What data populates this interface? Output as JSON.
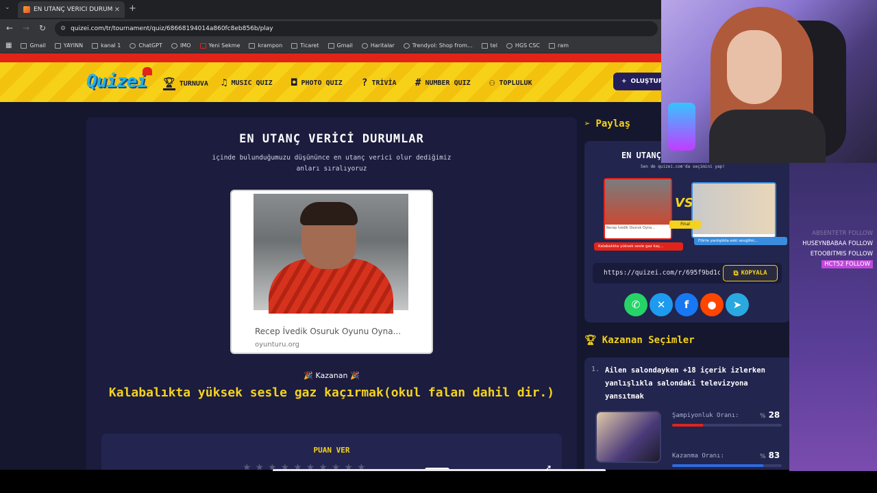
{
  "browser": {
    "tab_title": "EN UTANÇ VERİCİ DURUMLAR",
    "url": "quizei.com/tr/tournament/quiz/68668194014a860fc8eb856b/play",
    "bookmarks": [
      "Gmail",
      "YAYINN",
      "kanal 1",
      "ChatGPT",
      "IMO",
      "Yeni Sekme",
      "krampon",
      "Ticaret",
      "Gmail",
      "Haritalar",
      "Trendyol: Shop from...",
      "tel",
      "HGS CSC",
      "ram"
    ]
  },
  "site": {
    "logo": "Quizei",
    "nav": [
      "TURNUVA",
      "MUSIC QUIZ",
      "PHOTO QUIZ",
      "TRİVİA",
      "NUMBER QUIZ",
      "TOPLULUK"
    ],
    "create_label": "OLUŞTUR"
  },
  "quiz": {
    "title": "EN UTANÇ VERİCİ DURUMLAR",
    "subtitle": "içinde bulunduğumuzu düşününce en utanç verici olur dediğimiz anları sıralıyoruz",
    "image_caption": "Recep İvedik Osuruk Oyunu Oyna...",
    "image_source": "oyunturu.org",
    "winner_label": "🎉  Kazanan  🎉",
    "winner_text": "Kalabalıkta yüksek sesle gaz kaçırmak(okul falan dahil dir.)",
    "rate_label": "PUAN VER",
    "stars": "★★★★★★★★★★"
  },
  "share": {
    "title": "Paylaş",
    "preview_title": "EN UTANÇ",
    "preview_sub": "Sen de quizei.com'da seçimini yap!",
    "preview_logo": "Quizei",
    "preview_vs": "VS",
    "preview_final": "Final",
    "preview_a_caption": "Recep İvedik Osuruk Oyna...",
    "preview_a_label": "Kalabalıkta yüksek sesle gaz kaç...",
    "preview_b_label": "Flörte yanlışlıkla eski sevgilini...",
    "link": "https://quizei.com/r/695f9bd1c",
    "copy_label": "KOPYALA",
    "socials": [
      "whatsapp",
      "x",
      "facebook",
      "reddit",
      "telegram"
    ]
  },
  "winners": {
    "title": "Kazanan Seçimler",
    "items": [
      {
        "num": "1.",
        "text": "Ailen salondayken +18 içerik izlerken yanlışlıkla salondaki televizyona yansıtmak",
        "champ_label": "Şampiyonluk Oranı:",
        "champ_value": "28",
        "win_label": "Kazanma Oranı:",
        "win_value": "83",
        "pct": "%"
      }
    ]
  },
  "stream_overlay": {
    "follows": [
      {
        "text": "ABSENTETR  FOLLOW",
        "style": "faded"
      },
      {
        "text": "HUSEYNBABAA  FOLLOW",
        "style": "normal"
      },
      {
        "text": "ETOOBITMIS  FOLLOW",
        "style": "normal"
      },
      {
        "text": "HCT52  FOLLOW",
        "style": "hl"
      }
    ]
  },
  "colors": {
    "accent_yellow": "#f5d21c",
    "brand_red": "#e2231a",
    "card_bg": "#1b1c3e",
    "panel_bg": "#22254e"
  }
}
